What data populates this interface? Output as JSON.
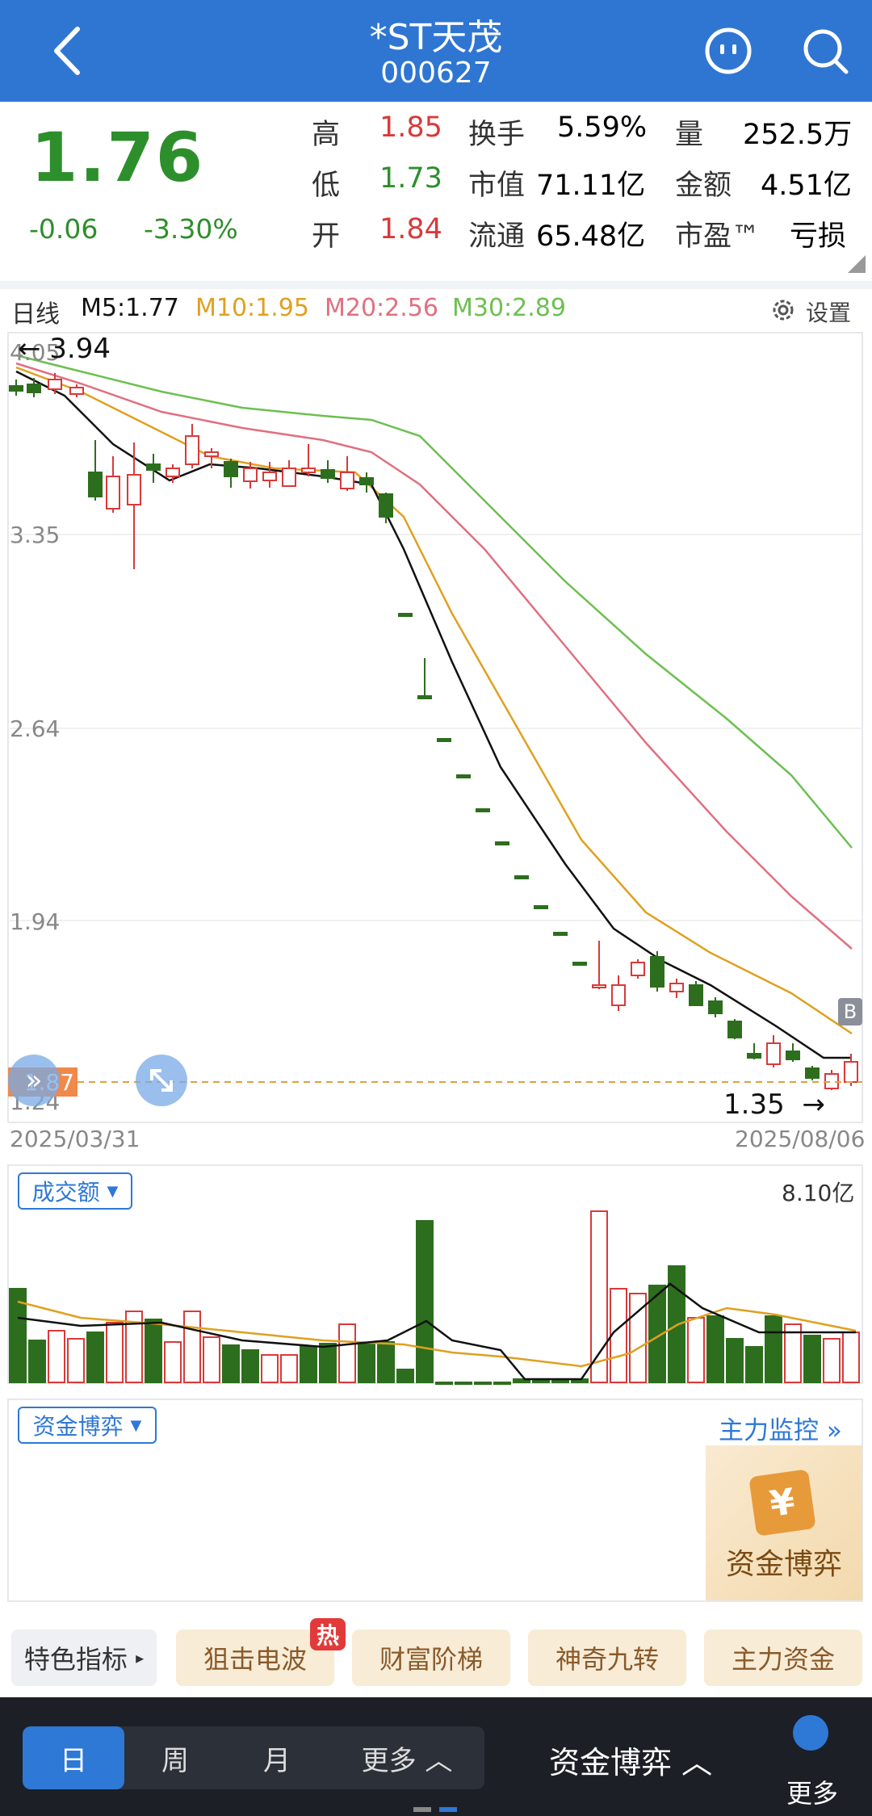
{
  "header": {
    "title": "*ST天茂",
    "code": "000627"
  },
  "quote": {
    "price": "1.76",
    "change": "-0.06",
    "change_pct": "-3.30%",
    "rows": [
      {
        "l1": "高",
        "v1": "1.85",
        "l2": "换手",
        "v2": "5.59%",
        "l3": "量",
        "v3": "252.5万"
      },
      {
        "l1": "低",
        "v1": "1.73",
        "l2": "市值",
        "v2": "71.11亿",
        "l3": "金额",
        "v3": "4.51亿"
      },
      {
        "l1": "开",
        "v1": "1.84",
        "l2": "流通",
        "v2": "65.48亿",
        "l3": "市盈™",
        "v3": "亏损"
      }
    ]
  },
  "ma_bar": {
    "period": "日线",
    "m5": "M5:1.77",
    "m10": "M10:1.95",
    "m20": "M20:2.56",
    "m30": "M30:2.89",
    "settings": "设置"
  },
  "kline": {
    "y_ticks": [
      "4.05",
      "3.35",
      "2.64",
      "1.94",
      "1.24"
    ],
    "high_label": "3.94",
    "low_label": "1.35",
    "current_tag": "1.87",
    "b_marker": "B",
    "start_date": "2025/03/31",
    "end_date": "2025/08/06"
  },
  "volume": {
    "selector": "成交额",
    "max_label": "8.10亿"
  },
  "fund": {
    "selector": "资金博弈",
    "monitor_link": "主力监控",
    "card_text": "资金博弈"
  },
  "indicators": {
    "title": "特色指标",
    "items": [
      "狙击电波",
      "财富阶梯",
      "神奇九转",
      "主力资金"
    ],
    "hot_badge": "热"
  },
  "bottom_bar": {
    "tabs": [
      "日",
      "周",
      "月",
      "更多"
    ],
    "active": "日",
    "fund_label": "资金博弈",
    "more_label": "更多"
  },
  "colors": {
    "header": "#2f76d2",
    "up": "#d83a3a",
    "down": "#2d6e1e",
    "ma5": "#111111",
    "ma10": "#e0a020",
    "ma20": "#e07080",
    "ma30": "#6cc050"
  }
}
